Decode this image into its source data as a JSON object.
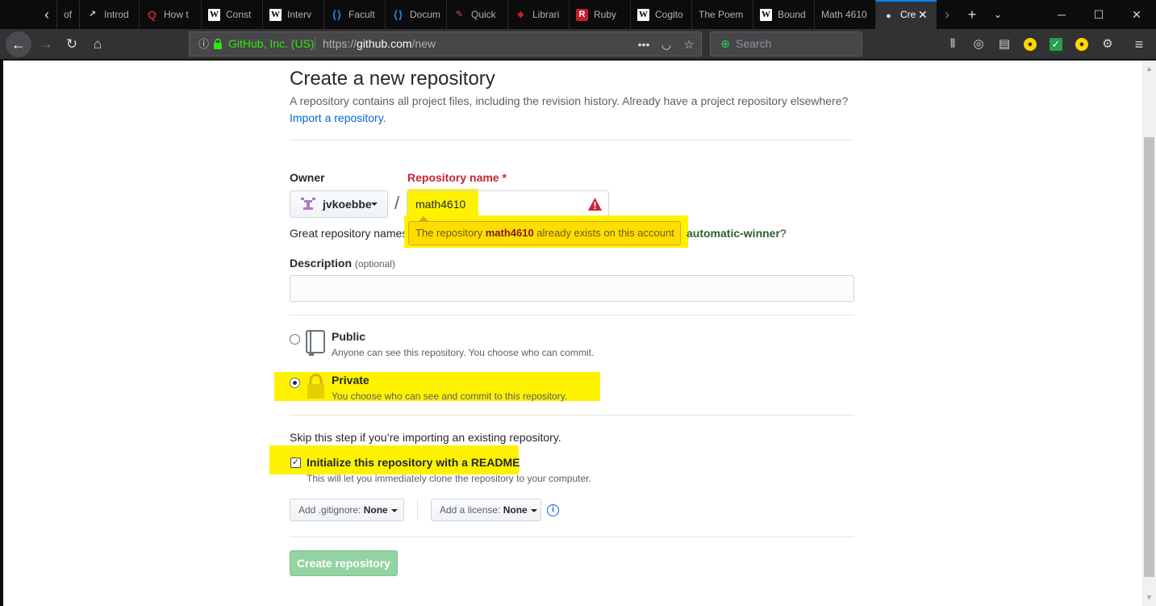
{
  "browser": {
    "tabs": [
      {
        "icon": "",
        "label": "of"
      },
      {
        "icon": "chart-icon",
        "label": "Introd"
      },
      {
        "icon": "quora-icon",
        "label": "How t"
      },
      {
        "icon": "wikipedia-icon",
        "label": "Const"
      },
      {
        "icon": "wikipedia-icon",
        "label": "Interv"
      },
      {
        "icon": "vscode-icon",
        "label": "Facult"
      },
      {
        "icon": "vscode-icon",
        "label": "Docum"
      },
      {
        "icon": "pencil-icon",
        "label": "Quick"
      },
      {
        "icon": "ruby-icon",
        "label": "Librari"
      },
      {
        "icon": "r-icon",
        "label": "Ruby"
      },
      {
        "icon": "wikipedia-icon",
        "label": "Cogito"
      },
      {
        "icon": "",
        "label": "The Poem"
      },
      {
        "icon": "wikipedia-icon",
        "label": "Bound"
      },
      {
        "icon": "",
        "label": "Math 4610"
      },
      {
        "icon": "github-icon",
        "label": "Cre"
      }
    ],
    "identity": "GitHub, Inc. (US)",
    "url_prefix": "https://",
    "url_host": "github.com",
    "url_path": "/new",
    "search_placeholder": "Search"
  },
  "page": {
    "title": "Create a new repository",
    "lead": "A repository contains all project files, including the revision history. Already have a project repository elsewhere?",
    "import_link": "Import a repository.",
    "owner_label": "Owner",
    "owner_value": "jvkoebbe",
    "repo_label": "Repository name",
    "repo_required": "*",
    "slash": "/",
    "repo_value": "math4610",
    "tooltip_pre": "The repository ",
    "tooltip_name": "math4610",
    "tooltip_post": " already exists on this account",
    "great_text": "Great repository names",
    "suggestion": "automatic-winner",
    "suggestion_suffix": "?",
    "desc_label": "Description",
    "desc_optional": "(optional)",
    "public_title": "Public",
    "public_sub": "Anyone can see this repository. You choose who can commit.",
    "private_title": "Private",
    "private_sub": "You choose who can see and commit to this repository.",
    "skip_text": "Skip this step if you’re importing an existing repository.",
    "init_label": "Initialize this repository with a README",
    "init_sub": "This will let you immediately clone the repository to your computer.",
    "gitignore_label": "Add .gitignore:",
    "gitignore_value": "None",
    "license_label": "Add a license:",
    "license_value": "None",
    "create_button": "Create repository",
    "visibility_selected": "Private",
    "init_readme_checked": true
  },
  "colors": {
    "highlight": "#fff200",
    "tooltip": "#ffdd00",
    "required": "#cb2431",
    "link": "#0366d6",
    "create_button": "#94d3a2",
    "identity_green": "#30e60b"
  }
}
